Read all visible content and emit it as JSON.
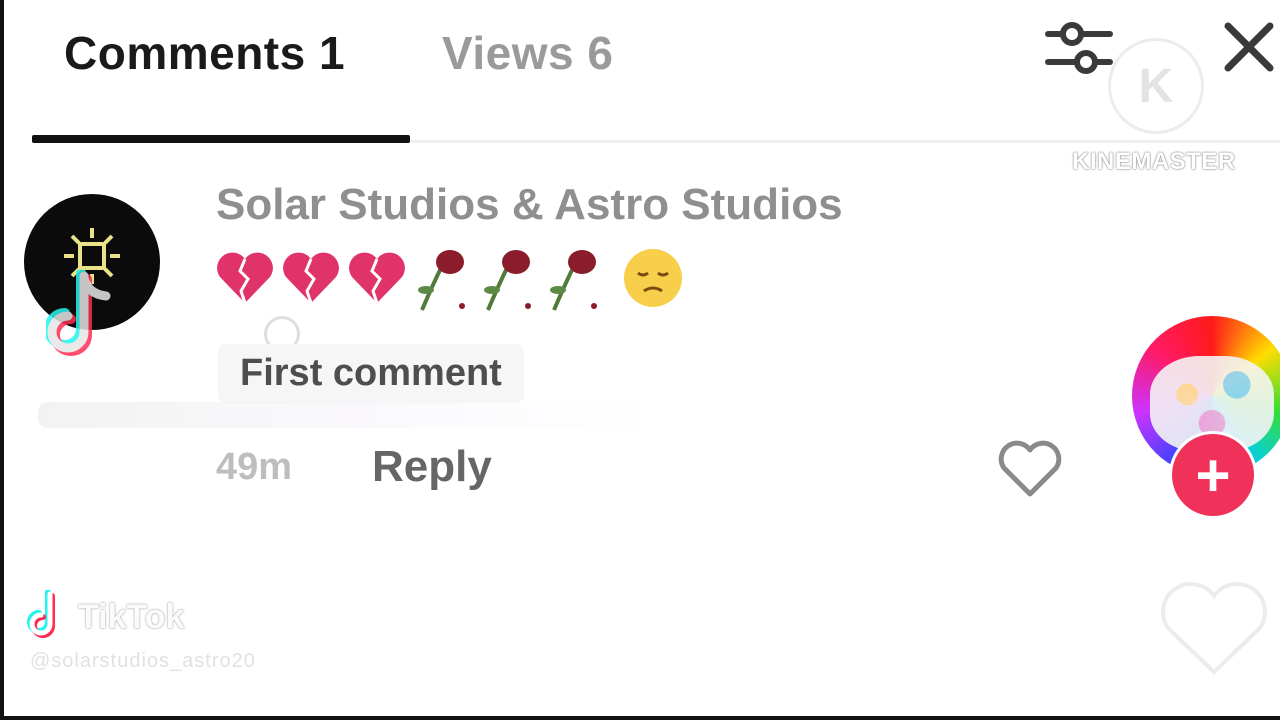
{
  "tabs": {
    "comments": "Comments 1",
    "views": "Views 6"
  },
  "watermark": {
    "logo_letter": "K",
    "brand": "KINEMASTER"
  },
  "comment": {
    "username": "Solar Studios & Astro Studios",
    "emojis": [
      "broken-heart",
      "broken-heart",
      "broken-heart",
      "wilted-rose",
      "wilted-rose",
      "wilted-rose",
      "sad-face"
    ],
    "badge": "First comment",
    "time": "49m",
    "reply_label": "Reply"
  },
  "follow": {
    "plus": "+"
  },
  "footer": {
    "tiktok_text": "TikTok",
    "handle": "@solarstudios_astro20"
  },
  "colors": {
    "accent": "#f0325a",
    "tab_active": "#1a1a1a",
    "tab_inactive": "#9a9a9a",
    "username": "#8f8f8f"
  }
}
